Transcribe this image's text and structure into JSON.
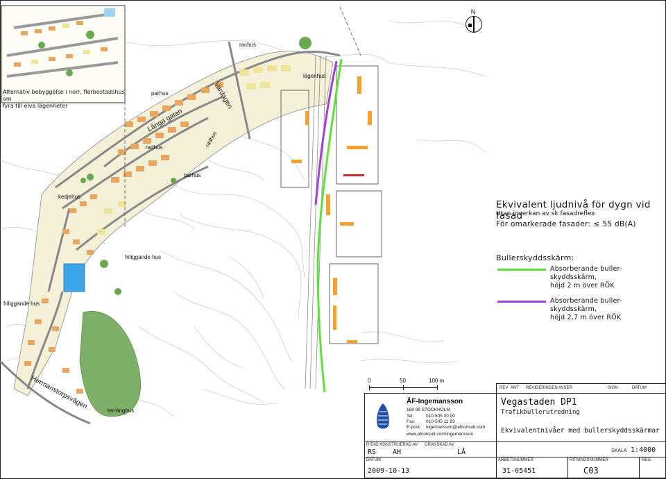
{
  "north_label": "N",
  "inset": {
    "caption_line1": "Alternativ bebyggelse i norr, flerbostadshus om",
    "caption_line2": "fyra till elva lägenheter"
  },
  "map_labels": {
    "rachus": "rachus",
    "parhus_1": "parhus",
    "radhus_1": "radhus",
    "langa_gatan": "Långa gatan",
    "vardagen": "Vardagen",
    "radhus_2": "radhus",
    "parhus_2": "parhus",
    "kedjehus": "kedjehus",
    "friliggande_hus_1": "friliggande hus",
    "friliggande_hus_2": "friliggande hus",
    "hermanstorpsvagen": "Hermanstorpsvägen",
    "terranghus": "terränghus",
    "lagenhus": "lägenhus"
  },
  "title": {
    "line1": "Ekvivalent ljudnivå för dygn vid fasad",
    "line2": "Utan inverkan av sk fasadreflex",
    "line3_prefix": "För omarkerade fasader:",
    "line3_symbol": "≤",
    "line3_value": "55 dB(A)"
  },
  "legend": {
    "heading": "Bullerskyddsskärm:",
    "items": [
      {
        "color": "#5fe03a",
        "line1": "Absorberande buller-",
        "line2": "skyddsskärm,",
        "line3": "höjd 2 m över RÖK"
      },
      {
        "color": "#a33ed6",
        "line1": "Absorberande buller-",
        "line2": "skyddsskärm,",
        "line3": "höjd 2,7 m över RÖK"
      }
    ]
  },
  "scalebar": {
    "t0": "0",
    "t50": "50",
    "t100": "100 m"
  },
  "revision_header": {
    "rev": "REV",
    "ant": "ANT",
    "revideringen": "REVIDERINGEN AVSER",
    "sign": "SIGN",
    "datum": "DATUM"
  },
  "company": {
    "name": "ÅF-Ingemansson",
    "address": "169 99 STOCKHOLM",
    "tel_label": "Tel:",
    "tel": "010-505 00 00",
    "fax_label": "Fax:",
    "fax": "010-505 11 83",
    "email_label": "E-post:",
    "email": "ingemansson@afconsult.com",
    "web": "www.afconsult.com/ingemansson"
  },
  "project": {
    "name": "Vegastaden DP1",
    "subtitle": "Trafikbullerutredning",
    "drawing": "Ekvivalentnivåer med bullerskyddsskärmar"
  },
  "titleblock": {
    "ritad_label": "RITAD KONSTRUERAD AV",
    "ritad_value": "RS",
    "konstruerad_value": "AH",
    "granskad_label": "GRANSKAD AV",
    "granskad_value": "LÅ",
    "skala_label": "SKALA",
    "skala_value": "1:4000",
    "datum_label": "DATUM",
    "datum_value": "2009-10-13",
    "arbetsnummer_label": "ARBETSNUMMER",
    "arbetsnummer_value": "31-05451",
    "ritningsnummer_label": "RITNINGSNUMMER",
    "ritningsnummer_value": "C03",
    "reg_label": "REG"
  }
}
